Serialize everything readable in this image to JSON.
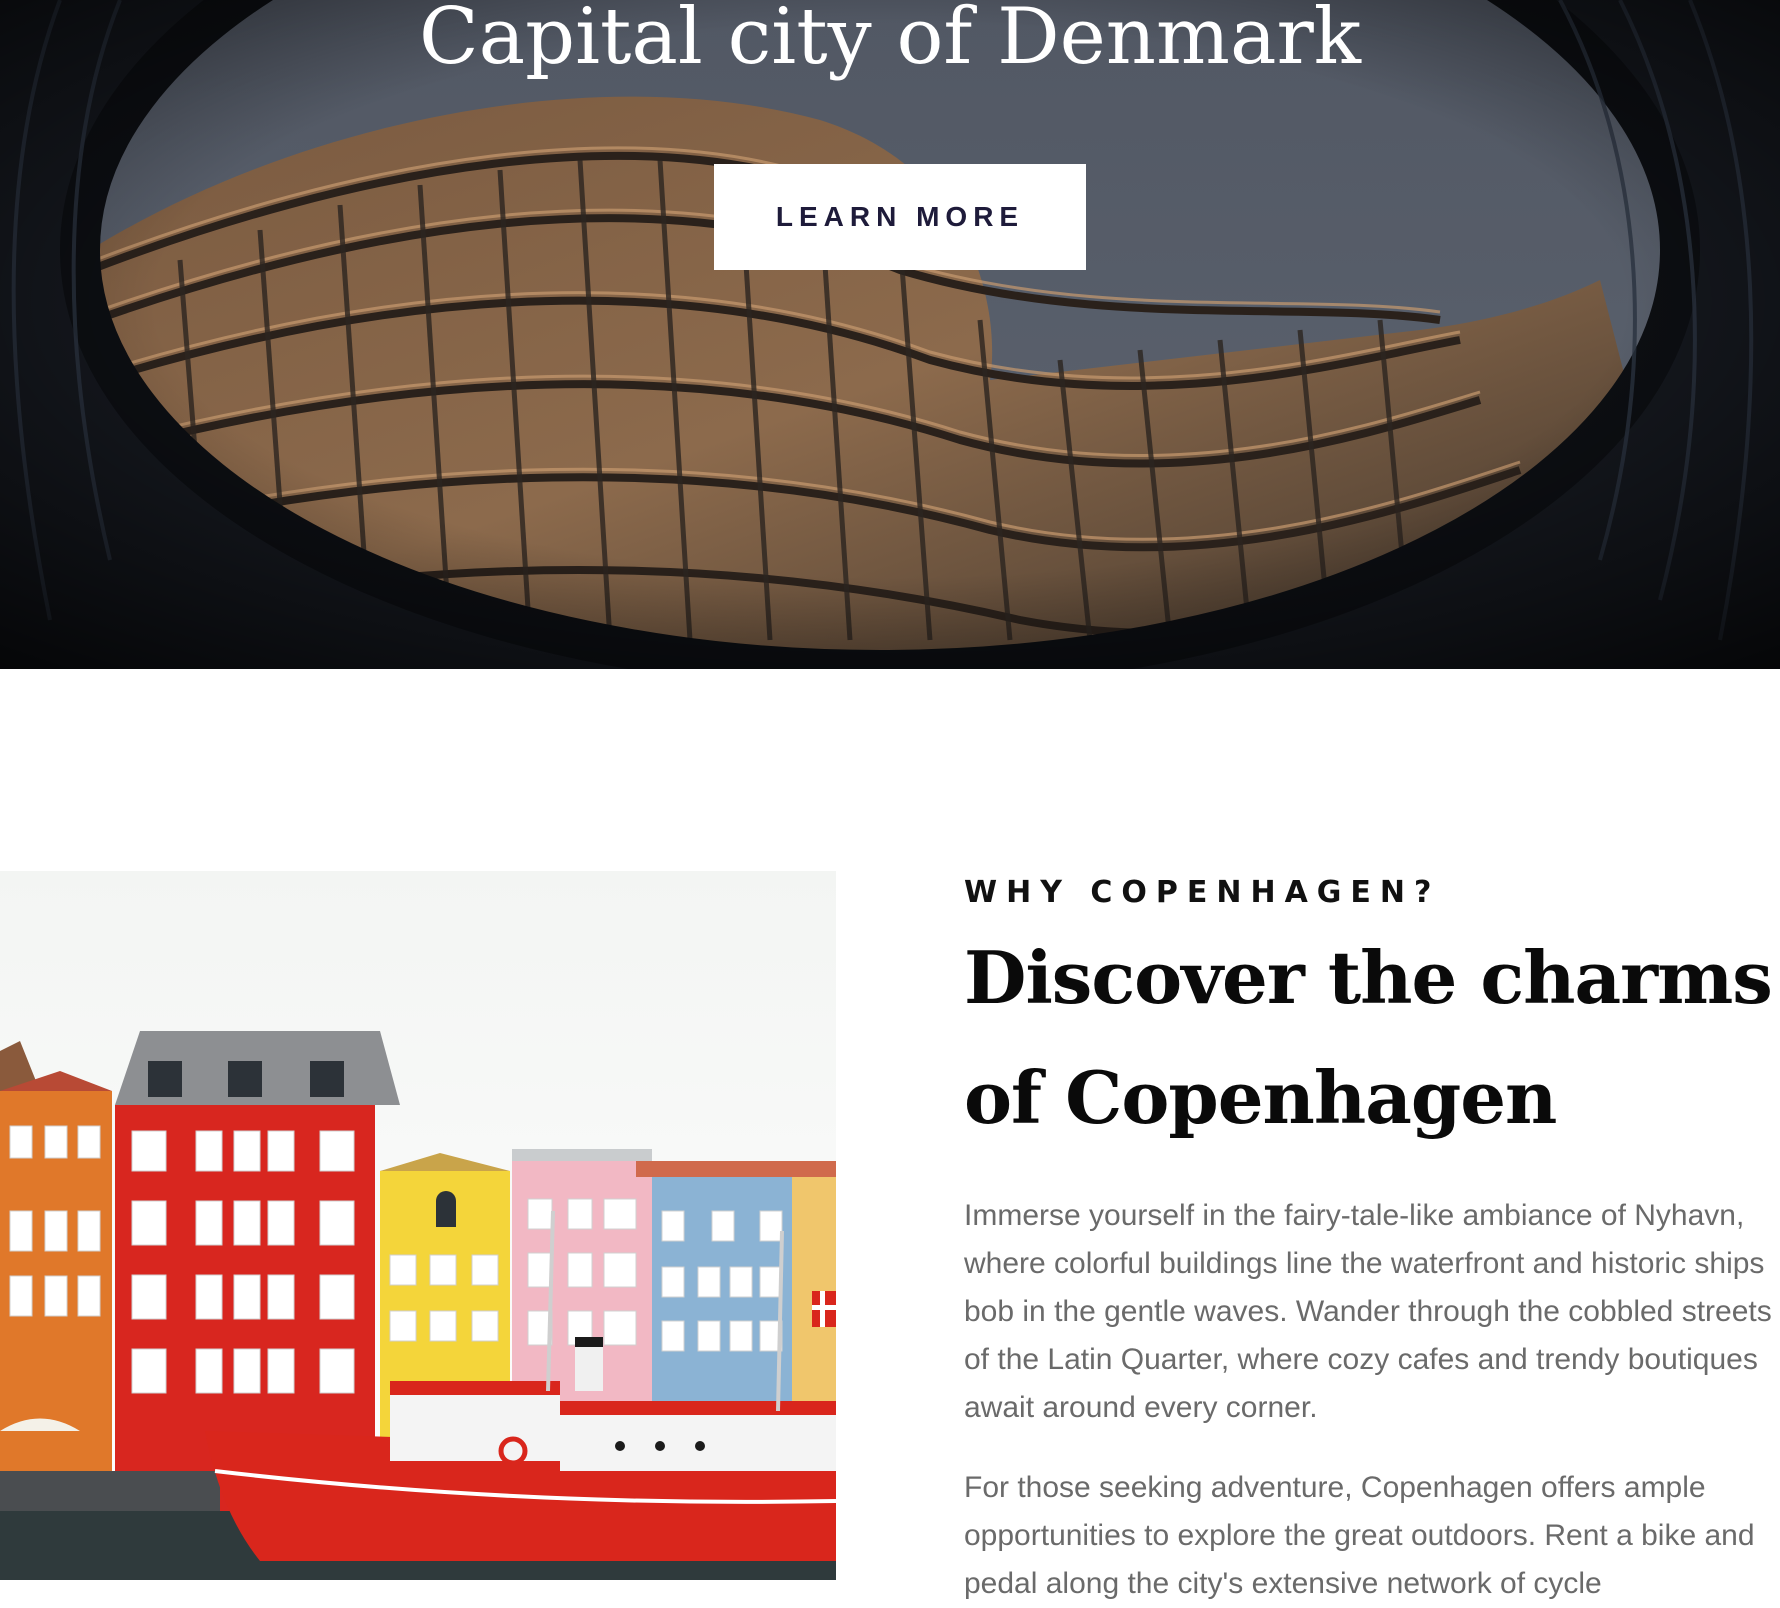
{
  "hero": {
    "title": "Capital city of Denmark",
    "button_label": "LEARN MORE"
  },
  "intro": {
    "eyebrow": "WHY COPENHAGEN?",
    "heading": "Discover the charms of Copenhagen",
    "paragraph_1": "Immerse yourself in the fairy-tale-like ambiance of Nyhavn, where colorful buildings line the waterfront and historic ships bob in the gentle waves. Wander through the cobbled streets of the Latin Quarter, where cozy cafes and trendy boutiques await around every corner.",
    "paragraph_2": "For those seeking adventure, Copenhagen offers ample opportunities to explore the great outdoors. Rent a bike and pedal along the city's extensive network of cycle"
  },
  "colors": {
    "button_text": "#1e1b3a",
    "heading": "#0a0a0a",
    "body_text": "#6a6a6a"
  }
}
